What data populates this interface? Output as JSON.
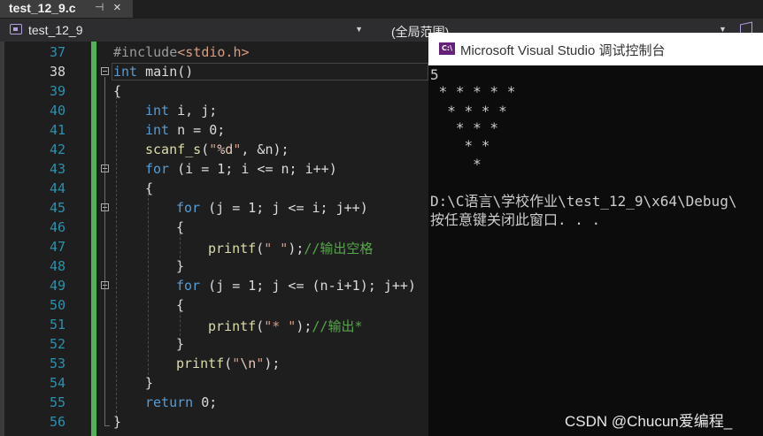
{
  "tab": {
    "title": "test_12_9.c",
    "pin_glyph": "⊣",
    "close_glyph": "×"
  },
  "navbar": {
    "project": "test_12_9",
    "scope": "(全局范围)",
    "dropdown_glyph": "▼"
  },
  "editor": {
    "current_line": 38,
    "line_numbers": [
      "37",
      "38",
      "39",
      "40",
      "41",
      "42",
      "43",
      "44",
      "45",
      "46",
      "47",
      "48",
      "49",
      "50",
      "51",
      "52",
      "53",
      "54",
      "55",
      "56"
    ],
    "code": {
      "l37_include": "#include",
      "l37_header": "<stdio.h>",
      "l38_kw": "int",
      "l38_rest": " main()",
      "l39": "{",
      "l40_kw": "int",
      "l40_rest": " i, j;",
      "l41_kw": "int",
      "l41_rest": " n = 0;",
      "l42_fn": "scanf_s",
      "l42_a": "(",
      "l42_str1": "\"",
      "l42_esc": "%d",
      "l42_str2": "\"",
      "l42_b": ", &n);",
      "l43_kw": "for",
      "l43_rest": " (i = 1; i <= n; i++)",
      "l44": "{",
      "l45_kw": "for",
      "l45_rest": " (j = 1; j <= i; j++)",
      "l46": "{",
      "l47_fn": "printf",
      "l47_a": "(",
      "l47_str": "\" \"",
      "l47_b": ");",
      "l47_cm": "//输出空格",
      "l48": "}",
      "l49_kw": "for",
      "l49_rest": " (j = 1; j <= (n-i+1); j++)",
      "l50": "{",
      "l51_fn": "printf",
      "l51_a": "(",
      "l51_str": "\"* \"",
      "l51_b": ");",
      "l51_cm": "//输出*",
      "l52": "}",
      "l53_fn": "printf",
      "l53_a": "(",
      "l53_str1": "\"",
      "l53_esc": "\\n",
      "l53_str2": "\"",
      "l53_b": ");",
      "l54": "}",
      "l55_kw": "return",
      "l55_rest": " 0;",
      "l56": "}"
    }
  },
  "console": {
    "icon_text": "C:\\",
    "title": "Microsoft Visual Studio 调试控制台",
    "lines": [
      "5",
      " * * * * *",
      "  * * * *",
      "   * * *",
      "    * *",
      "     *",
      "",
      "D:\\C语言\\学校作业\\test_12_9\\x64\\Debug\\",
      "按任意键关闭此窗口. . ."
    ]
  },
  "watermark": "CSDN @Chucun爱编程_",
  "colors": {
    "keyword": "#569cd6",
    "string": "#d69d85",
    "comment": "#57a64a",
    "line_number": "#2b91af",
    "change_bar": "#52b354"
  }
}
